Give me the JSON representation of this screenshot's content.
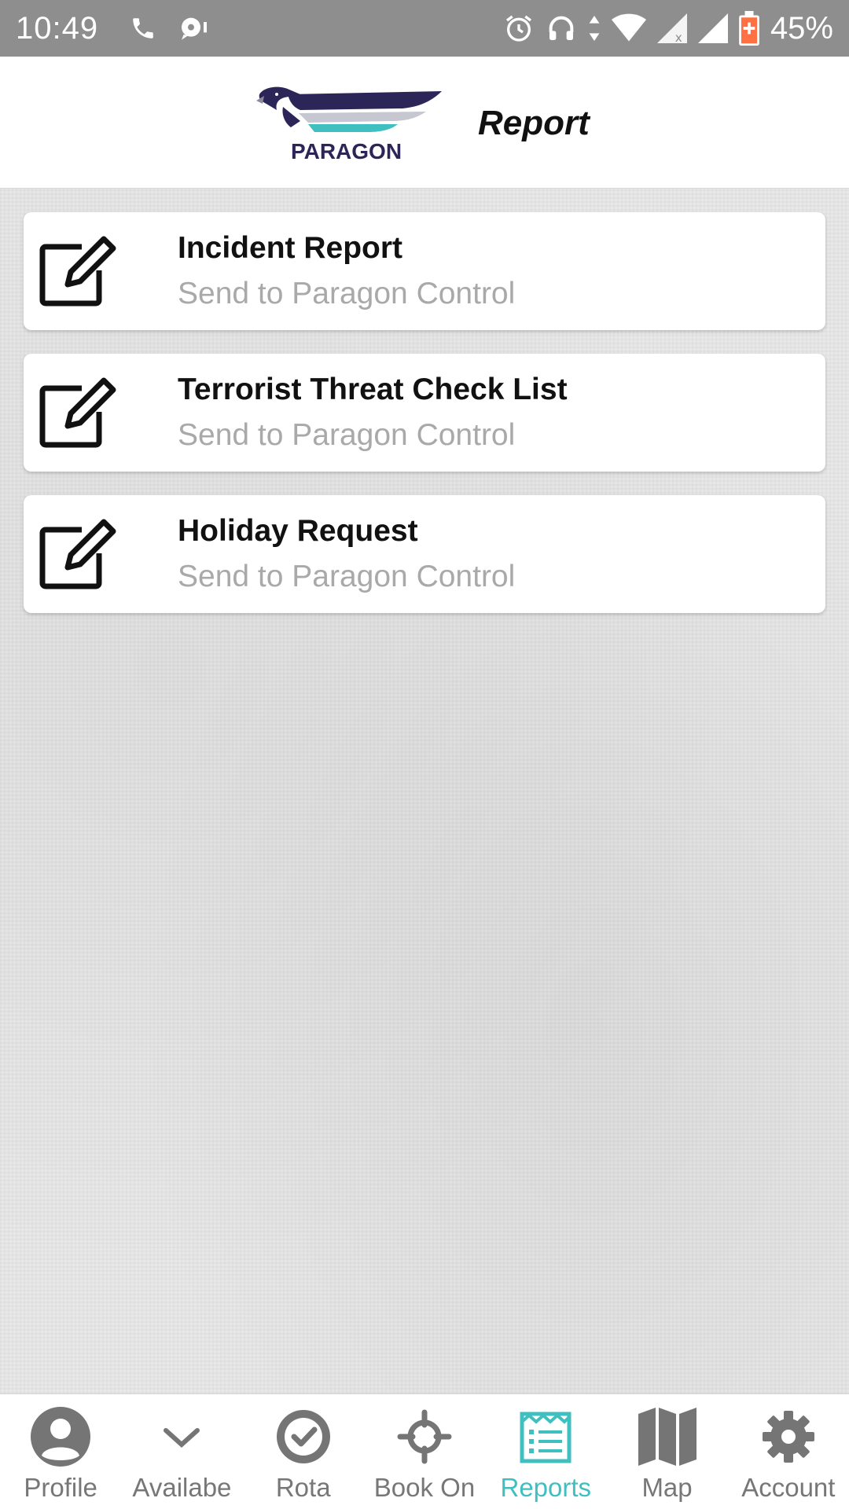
{
  "status_bar": {
    "time": "10:49",
    "battery": "45%",
    "icons": [
      "phone-icon",
      "chat-icon",
      "alarm-icon",
      "headphones-icon",
      "data-arrows-icon",
      "wifi-icon",
      "signal-icon",
      "signal-icon",
      "battery-icon"
    ]
  },
  "header": {
    "logo_text": "PARAGON",
    "title": "Report"
  },
  "reports": [
    {
      "title": "Incident Report",
      "subtitle": "Send to Paragon Control",
      "icon": "edit-icon"
    },
    {
      "title": "Terrorist Threat Check List",
      "subtitle": "Send to Paragon Control",
      "icon": "edit-icon"
    },
    {
      "title": "Holiday Request",
      "subtitle": "Send to Paragon Control",
      "icon": "edit-icon"
    }
  ],
  "nav": [
    {
      "label": "Profile",
      "icon": "user-icon",
      "active": false
    },
    {
      "label": "Availabe",
      "icon": "chevron-down-icon",
      "active": false
    },
    {
      "label": "Rota",
      "icon": "check-circle-icon",
      "active": false
    },
    {
      "label": "Book On",
      "icon": "crosshair-icon",
      "active": false
    },
    {
      "label": "Reports",
      "icon": "report-icon",
      "active": true
    },
    {
      "label": "Map",
      "icon": "map-icon",
      "active": false
    },
    {
      "label": "Account",
      "icon": "gear-icon",
      "active": false
    }
  ],
  "colors": {
    "accent": "#3fbfbf",
    "status_bar": "#8e8e8e",
    "logo_navy": "#2b2558",
    "logo_teal": "#3fbfbf",
    "subtitle_gray": "#a9a9a9",
    "nav_gray": "#777777",
    "battery_orange": "#ff7043"
  }
}
